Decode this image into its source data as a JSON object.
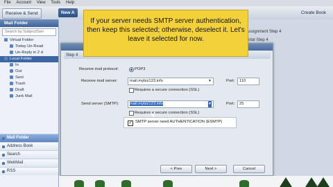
{
  "menubar": {
    "items": [
      "File",
      "Account",
      "View",
      "Tools",
      "Help"
    ]
  },
  "toolbar": {
    "main_button": "Receive & Send",
    "new_button": "New A",
    "far_button": "Create Book"
  },
  "left_panel": {
    "header": "Mail Folder",
    "search_placeholder": "Search by Subject/Sen",
    "tree": [
      {
        "label": "Virtual Folder",
        "level": 0
      },
      {
        "label": "Today Un-Read",
        "level": 1
      },
      {
        "label": "Un-Reply in 2 d",
        "level": 1
      },
      {
        "label": "Local Folder",
        "level": 0,
        "selected": true
      },
      {
        "label": "In",
        "level": 1
      },
      {
        "label": "Out",
        "level": 1
      },
      {
        "label": "Sent",
        "level": 1
      },
      {
        "label": "Trash",
        "level": 1
      },
      {
        "label": "Draft",
        "level": 1
      },
      {
        "label": "Junk Mail",
        "level": 1
      }
    ],
    "nav": [
      "Mail Folder",
      "Address Book",
      "Search",
      "WebMail",
      "RSS"
    ]
  },
  "background": {
    "step_texts": [
      "Assignment Step 4",
      "Total Step 4"
    ]
  },
  "dialog": {
    "band_text": "Step 4",
    "receive_protocol_label": "Receive mail protocol:",
    "receive_protocol_value": "POP3",
    "receive_server_label": "Receive mail server:",
    "receive_server_value": "mail.mybiz123.info",
    "receive_port_label": "Port:",
    "receive_port_value": "110",
    "receive_ssl_label": "Requires a secure connection (SSL)",
    "send_server_label": "Send server (SMTP):",
    "send_server_value": "mail.mybiz123.info",
    "send_port_label": "Port:",
    "send_port_value": "25",
    "send_ssl_label": "Requires a secure connection (SSL)",
    "auth_label": "SMTP server need AUTHENTICATION (ESMTP)",
    "buttons": {
      "prev": "< Prev",
      "next": "Next >",
      "cancel": "Cancel"
    }
  },
  "note": {
    "text": "If your server needs SMTP server authentication, then keep this selected; otherwise, deselect it. Let's leave it selected for now."
  },
  "colors": {
    "note_yellow": "#f3d13a",
    "selection_blue": "#3267b8",
    "frame_black": "#000000"
  }
}
